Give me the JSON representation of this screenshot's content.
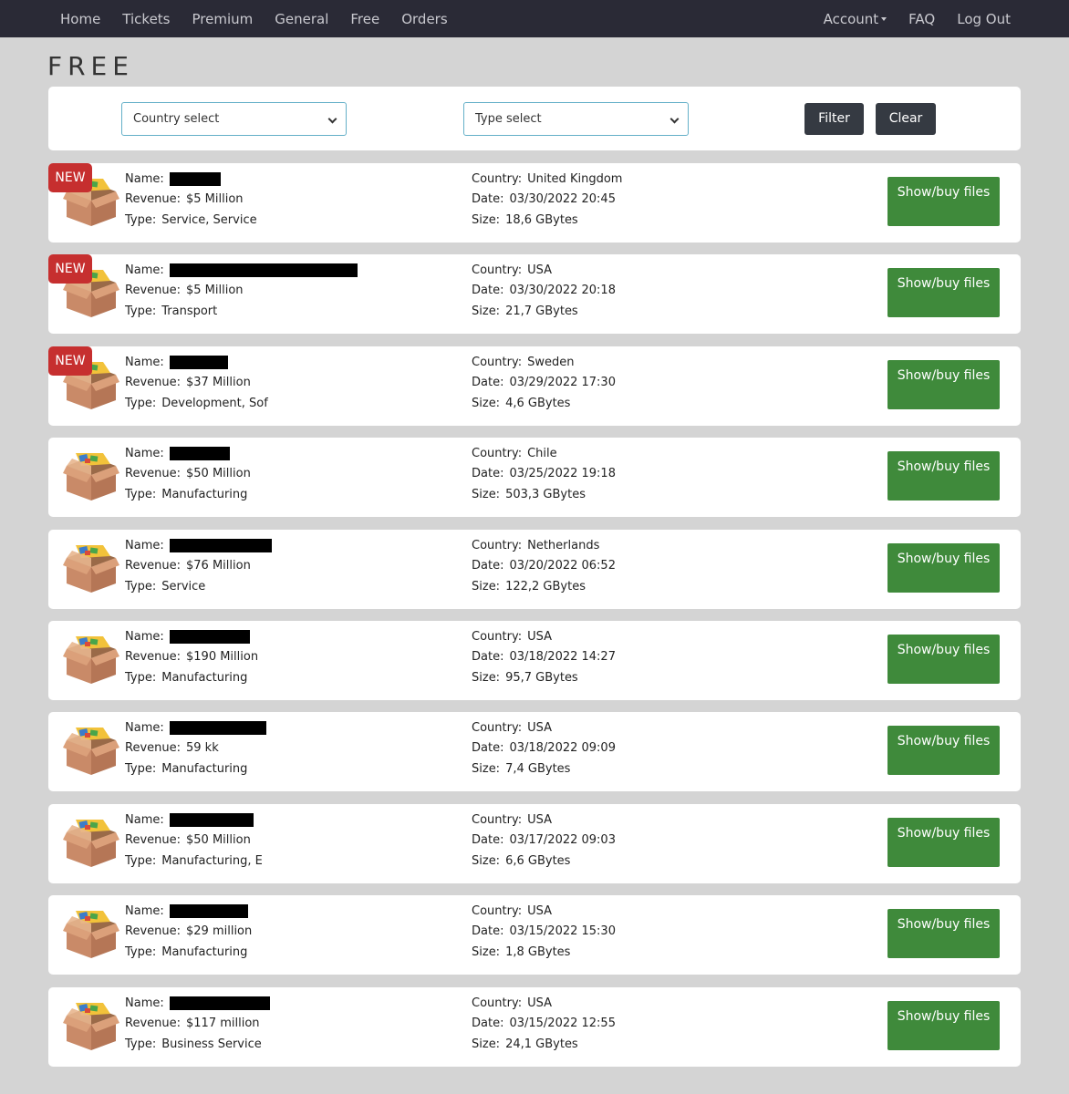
{
  "nav": {
    "left": [
      "Home",
      "Tickets",
      "Premium",
      "General",
      "Free",
      "Orders"
    ],
    "account": "Account",
    "faq": "FAQ",
    "logout": "Log Out"
  },
  "page_title": "FREE",
  "filters": {
    "country": "Country select",
    "type": "Type select",
    "filter_btn": "Filter",
    "clear_btn": "Clear"
  },
  "labels": {
    "name": "Name:",
    "revenue": "Revenue:",
    "type": "Type:",
    "country": "Country:",
    "date": "Date:",
    "size": "Size:",
    "button": "Show/buy files",
    "new_badge": "NEW"
  },
  "colors": {
    "navbar": "#2a2a36",
    "button_green": "#3f8a3b",
    "badge_red": "#c62f2f",
    "select_border": "#64b0c8"
  },
  "listings": [
    {
      "new": true,
      "revenue": "$5 Million",
      "type": "Service, Service",
      "country": "United Kingdom",
      "date": "03/30/2022 20:45",
      "size": "18,6 GBytes"
    },
    {
      "new": true,
      "revenue": "$5 Million",
      "type": "Transport",
      "country": "USA",
      "date": "03/30/2022 20:18",
      "size": "21,7 GBytes"
    },
    {
      "new": true,
      "revenue": "$37 Million",
      "type": "Development, Sof",
      "country": "Sweden",
      "date": "03/29/2022 17:30",
      "size": "4,6 GBytes"
    },
    {
      "new": false,
      "revenue": "$50 Million",
      "type": "Manufacturing",
      "country": "Chile",
      "date": "03/25/2022 19:18",
      "size": "503,3 GBytes"
    },
    {
      "new": false,
      "revenue": "$76 Million",
      "type": "Service",
      "country": "Netherlands",
      "date": "03/20/2022 06:52",
      "size": "122,2 GBytes"
    },
    {
      "new": false,
      "revenue": "$190 Million",
      "type": "Manufacturing",
      "country": "USA",
      "date": "03/18/2022 14:27",
      "size": "95,7 GBytes"
    },
    {
      "new": false,
      "revenue": "59 kk",
      "type": "Manufacturing",
      "country": "USA",
      "date": "03/18/2022 09:09",
      "size": "7,4 GBytes"
    },
    {
      "new": false,
      "revenue": "$50 Million",
      "type": "Manufacturing, E",
      "country": "USA",
      "date": "03/17/2022 09:03",
      "size": "6,6 GBytes"
    },
    {
      "new": false,
      "revenue": "$29 million",
      "type": "Manufacturing",
      "country": "USA",
      "date": "03/15/2022 15:30",
      "size": "1,8 GBytes"
    },
    {
      "new": false,
      "revenue": "$117 million",
      "type": "Business Service",
      "country": "USA",
      "date": "03/15/2022 12:55",
      "size": "24,1 GBytes"
    }
  ]
}
